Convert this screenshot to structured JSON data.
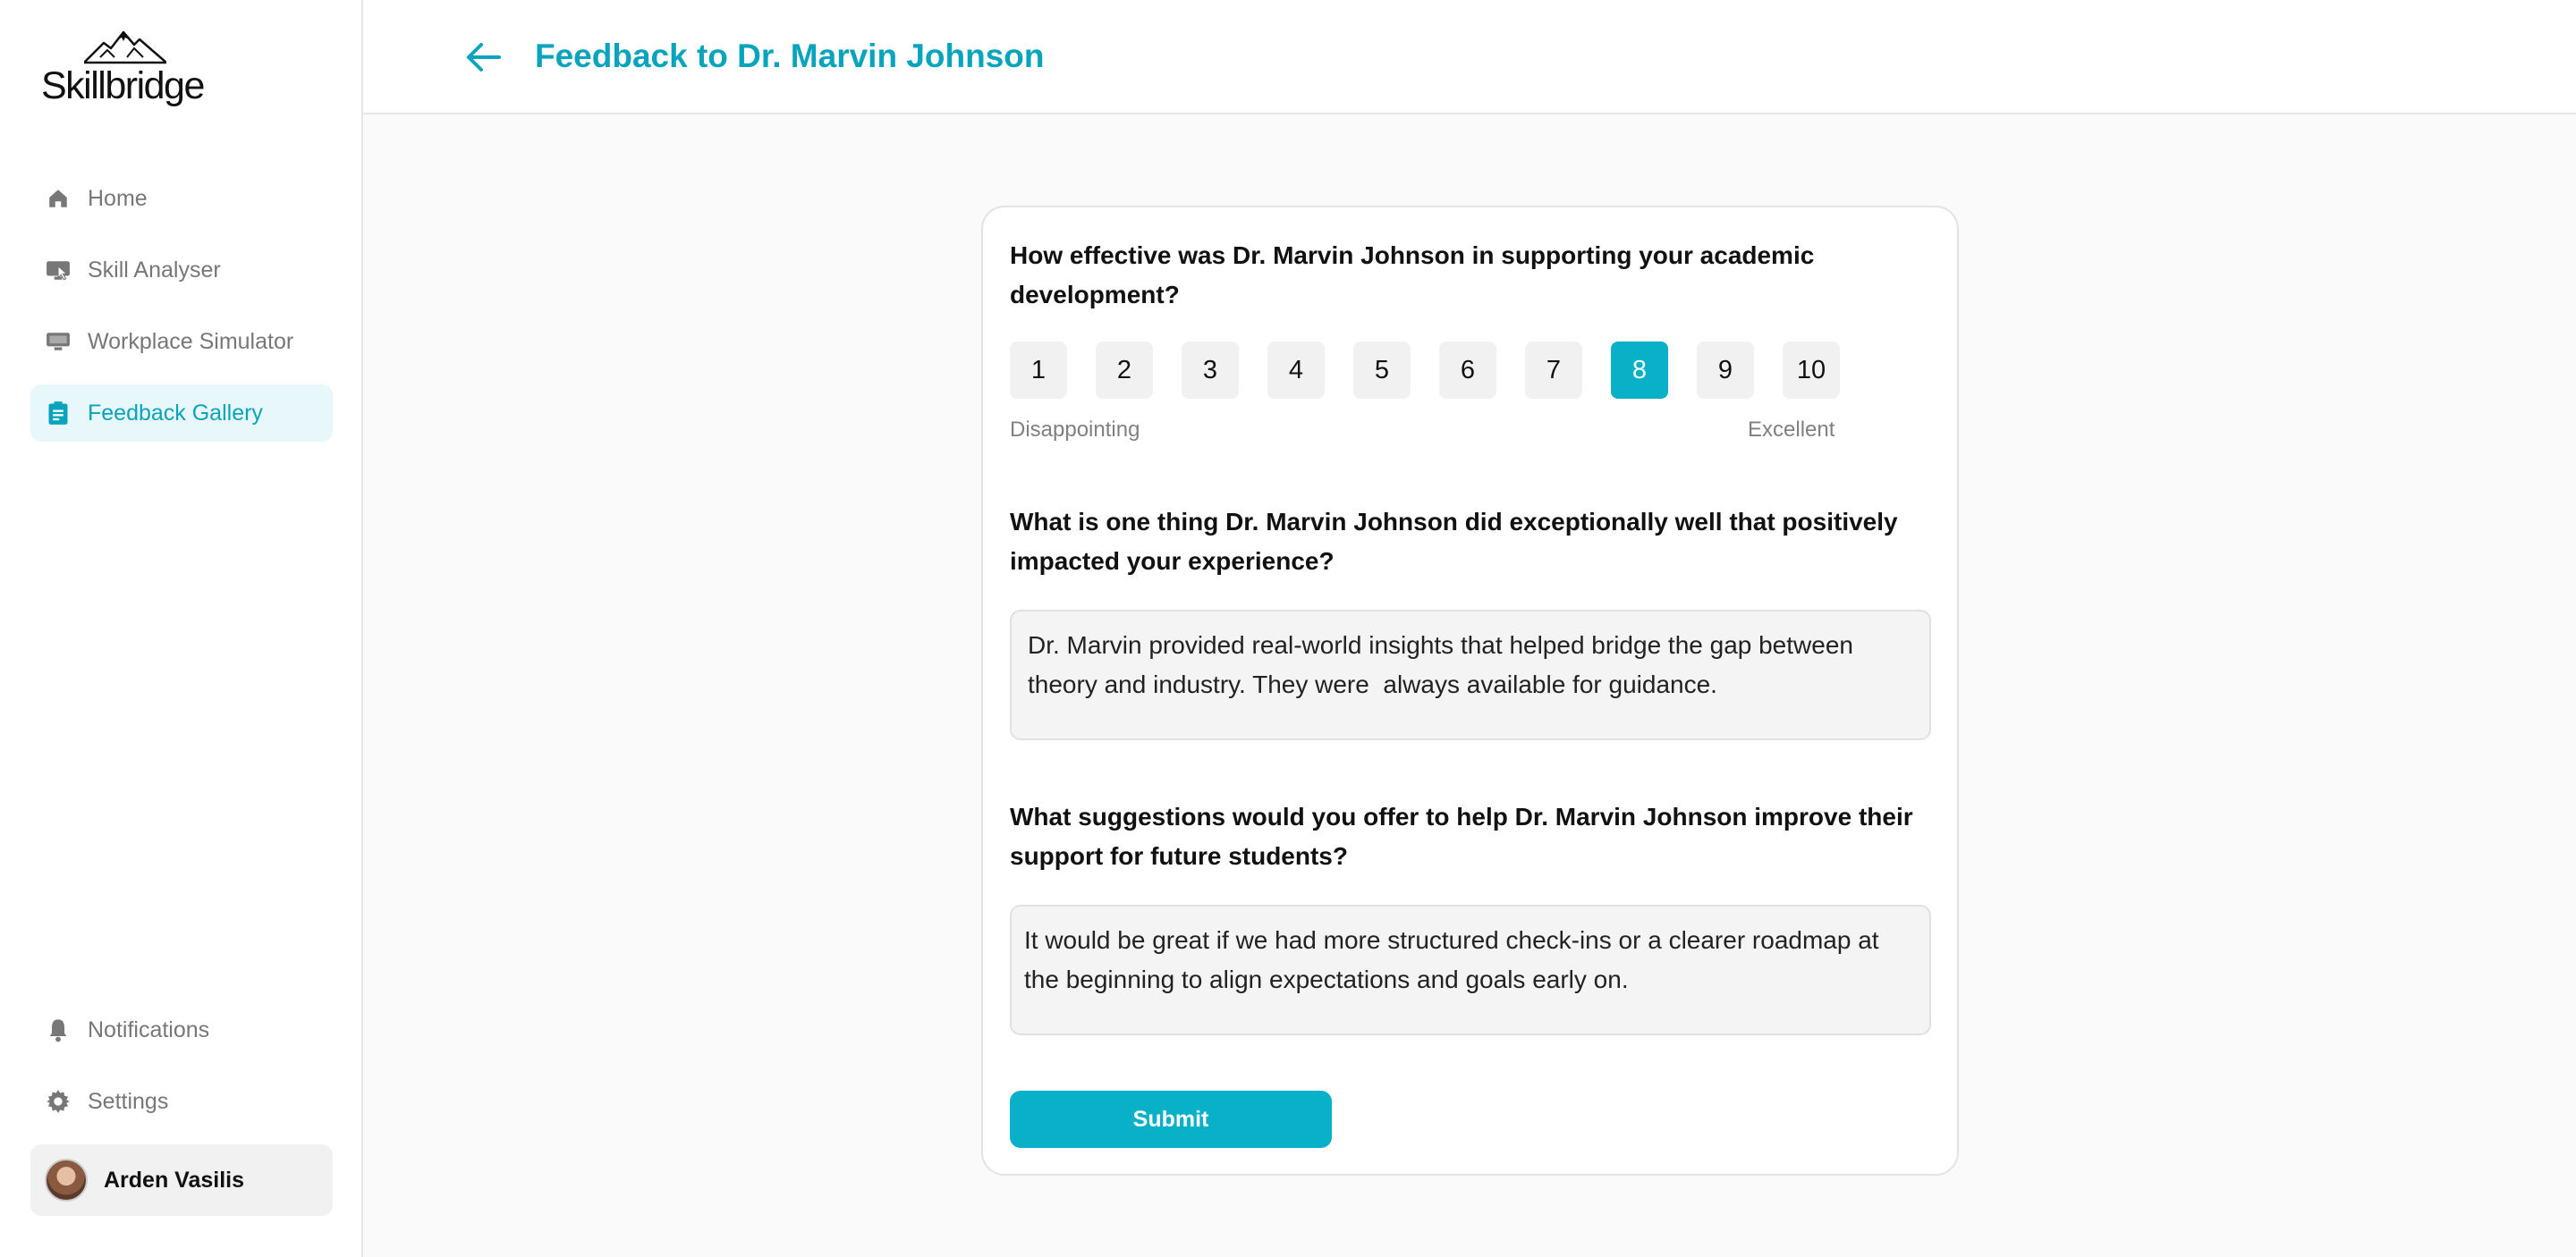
{
  "app": {
    "logo_text": "Skillbridge"
  },
  "sidebar": {
    "items": [
      {
        "label": "Home",
        "icon": "home-icon"
      },
      {
        "label": "Skill Analyser",
        "icon": "monitor-cursor-icon"
      },
      {
        "label": "Workplace Simulator",
        "icon": "desktop-icon"
      },
      {
        "label": "Feedback Gallery",
        "icon": "clipboard-icon",
        "active": true
      }
    ],
    "bottom_items": [
      {
        "label": "Notifications",
        "icon": "bell-icon"
      },
      {
        "label": "Settings",
        "icon": "gear-icon"
      }
    ],
    "user": {
      "name": "Arden Vasilis"
    }
  },
  "header": {
    "title": "Feedback to Dr. Marvin Johnson"
  },
  "form": {
    "q1": "How effective was Dr. Marvin Johnson in supporting your academic development?",
    "rating_options": [
      "1",
      "2",
      "3",
      "4",
      "5",
      "6",
      "7",
      "8",
      "9",
      "10"
    ],
    "rating_selected": 8,
    "scale_min_label": "Disappointing",
    "scale_max_label": "Excellent",
    "q2": "What is one thing Dr. Marvin Johnson did exceptionally well that positively impacted your experience?",
    "a2": "Dr. Marvin provided real-world insights that helped bridge the gap between theory and industry. They were  always available for guidance.",
    "q3": "What suggestions would you offer to help Dr. Marvin Johnson improve their support for future students?",
    "a3": "It would be great if we had more structured check-ins or a clearer roadmap at the beginning to align expectations and goals early on.",
    "submit_label": "Submit"
  },
  "colors": {
    "accent": "#08b0c8",
    "accent_text": "#08a4bd",
    "active_bg": "#e8f7f9"
  }
}
